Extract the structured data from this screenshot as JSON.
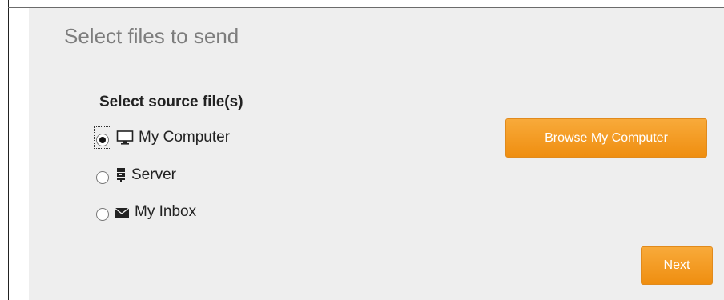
{
  "panel": {
    "title": "Select files to send"
  },
  "source": {
    "label": "Select source file(s)",
    "options": [
      {
        "label": "My Computer",
        "icon": "monitor-icon",
        "checked": true
      },
      {
        "label": "Server",
        "icon": "server-icon",
        "checked": false
      },
      {
        "label": "My Inbox",
        "icon": "envelope-icon",
        "checked": false
      }
    ]
  },
  "buttons": {
    "browse_label": "Browse My Computer",
    "next_label": "Next"
  },
  "colors": {
    "button_orange": "#f29a22",
    "panel_background": "#eeeeee",
    "title_gray": "#7d7d7d"
  }
}
